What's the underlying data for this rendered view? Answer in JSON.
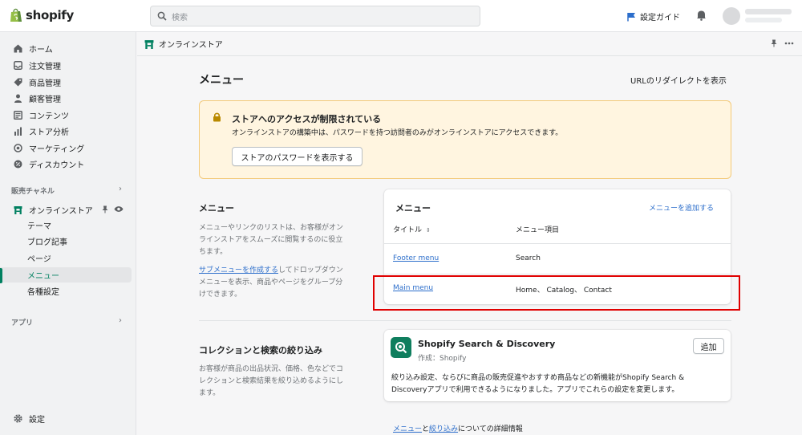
{
  "topbar": {
    "logo_text": "shopify",
    "search_placeholder": "検索",
    "setup_guide": "設定ガイド"
  },
  "sidebar": {
    "items": [
      {
        "label": "ホーム",
        "icon": "home-icon"
      },
      {
        "label": "注文管理",
        "icon": "orders-icon"
      },
      {
        "label": "商品管理",
        "icon": "tag-icon"
      },
      {
        "label": "顧客管理",
        "icon": "person-icon"
      },
      {
        "label": "コンテンツ",
        "icon": "content-icon"
      },
      {
        "label": "ストア分析",
        "icon": "bar-chart-icon"
      },
      {
        "label": "マーケティング",
        "icon": "target-icon"
      },
      {
        "label": "ディスカウント",
        "icon": "discount-icon"
      }
    ],
    "sales_channel_header": "販売チャネル",
    "online_store": "オンラインストア",
    "sub_items": [
      "テーマ",
      "ブログ記事",
      "ページ",
      "メニュー",
      "各種設定"
    ],
    "apps_header": "アプリ",
    "settings": "設定"
  },
  "app_header": {
    "title": "オンラインストア"
  },
  "main": {
    "page_title": "メニュー",
    "redirect_link": "URLのリダイレクトを表示",
    "banner": {
      "title": "ストアへのアクセスが制限されている",
      "text": "オンラインストアの構築中は、パスワードを持つ訪問者のみがオンラインストアにアクセスできます。",
      "button": "ストアのパスワードを表示する"
    },
    "menu_section": {
      "title": "メニュー",
      "desc_lines": [
        "メニューやリンクのリストは、お客様がオン",
        "ラインストアをスムーズに閲覧するのに役立",
        "ちます。"
      ],
      "link": "サブメニューを作成する",
      "link_after": "してドロップダウン",
      "desc2_lines": [
        "メニューを表示、商品やページをグループ分",
        "けできます。"
      ]
    },
    "menu_card": {
      "title": "メニュー",
      "add_link": "メニューを追加する",
      "col_title": "タイトル",
      "col_items": "メニュー項目",
      "rows": [
        {
          "title": "Footer menu",
          "items": "Search"
        },
        {
          "title": "Main menu",
          "items": "Home、 Catalog、 Contact"
        }
      ]
    },
    "collection_section": {
      "title": "コレクションと検索の絞り込み",
      "desc_lines": [
        "お客様が商品の出品状況、価格、色などでコ",
        "レクションと検索結果を絞り込めるようにし",
        "ます。"
      ]
    },
    "app_card": {
      "name": "Shopify Search & Discovery",
      "author": "作成：Shopify",
      "add_button": "追加",
      "desc_lines": [
        "絞り込み設定、ならびに商品の販売促進やおすすめ商品などの新機能がShopify Search &",
        "Discoveryアプリで利用できるようになりました。アプリでこれらの設定を変更します。"
      ]
    },
    "footer": {
      "link1": "メニュー",
      "and": "と",
      "link2": "絞り込み",
      "suffix": "についての詳細情報"
    }
  },
  "colors": {
    "accent_green": "#008060",
    "link_blue": "#2c6ecb",
    "banner_bg": "#fff5e0",
    "highlight_red": "#e00000"
  }
}
